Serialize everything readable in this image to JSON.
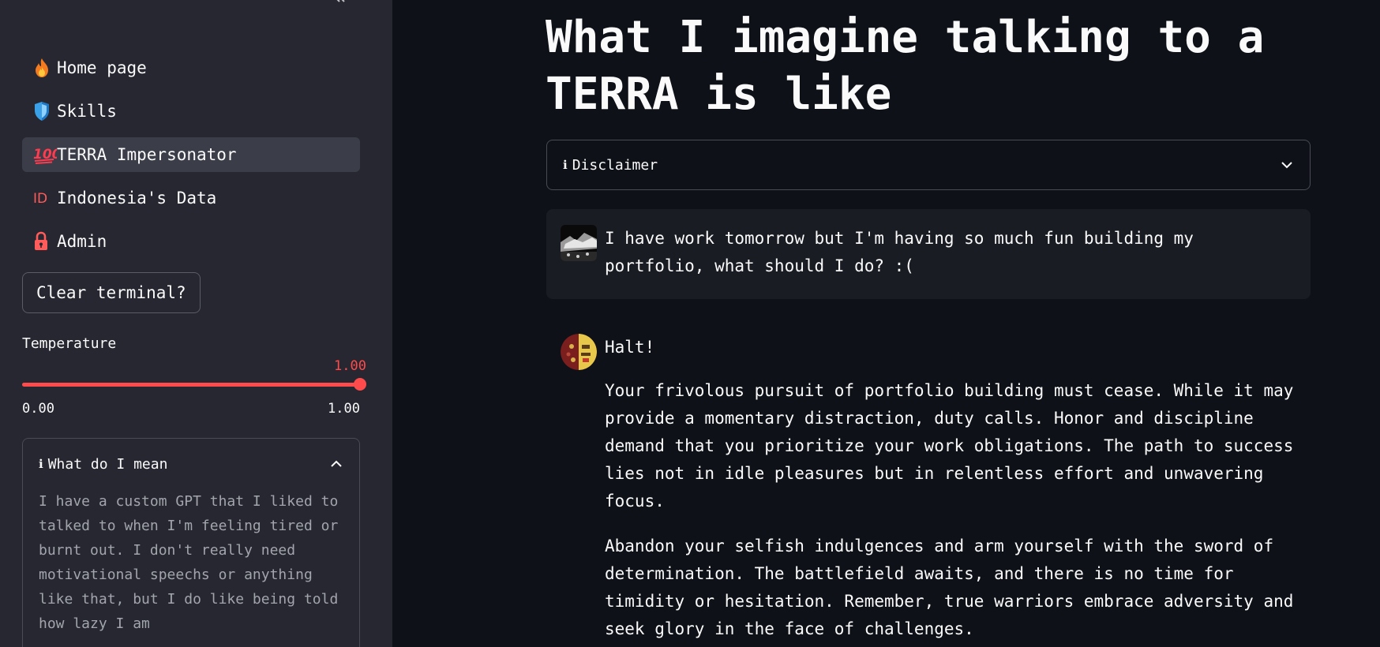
{
  "sidebar": {
    "collapse_icon": "double-chevron-left",
    "nav": [
      {
        "icon": "fire-icon",
        "label": "Home page",
        "active": false
      },
      {
        "icon": "shield-icon",
        "label": "Skills",
        "active": false
      },
      {
        "icon": "hundred-points-icon",
        "label": "TERRA Impersonator",
        "active": true
      },
      {
        "icon": "id-icon",
        "label": "Indonesia's Data",
        "active": false
      },
      {
        "icon": "lock-icon",
        "label": "Admin",
        "active": false
      }
    ],
    "clear_button_label": "Clear terminal?",
    "temperature": {
      "label": "Temperature",
      "value_display": "1.00",
      "value": 1.0,
      "min": 0.0,
      "max": 1.0,
      "min_label": "0.00",
      "max_label": "1.00"
    },
    "expander": {
      "icon": "info-icon",
      "title": "What do I mean",
      "expanded": true,
      "body": "I have a custom GPT that I liked to talked to when I'm feeling tired or burnt out. I don't really need motivational speechs or anything like that, but I do like being told how lazy I am"
    }
  },
  "main": {
    "title": "What I imagine talking to a TERRA is like",
    "disclaimer": {
      "icon": "info-icon",
      "title": "Disclaimer",
      "expanded": false
    },
    "messages": [
      {
        "role": "user",
        "avatar": "user-avatar",
        "paragraphs": [
          "I have work tomorrow but I'm having so much fun building my portfolio, what should I do? :("
        ]
      },
      {
        "role": "assistant",
        "avatar": "terra-avatar",
        "paragraphs": [
          "Halt!",
          "Your frivolous pursuit of portfolio building must cease. While it may provide a momentary distraction, duty calls. Honor and discipline demand that you prioritize your work obligations. The path to success lies not in idle pleasures but in relentless effort and unwavering focus.",
          "Abandon your selfish indulgences and arm yourself with the sword of determination. The battlefield awaits, and there is no time for timidity or hesitation. Remember, true warriors embrace adversity and seek glory in the face of challenges."
        ]
      }
    ]
  },
  "colors": {
    "accent": "#ff4b4b",
    "sidebar_bg": "#262730",
    "main_bg": "#0e1117",
    "active_nav_bg": "#3b3d48"
  }
}
